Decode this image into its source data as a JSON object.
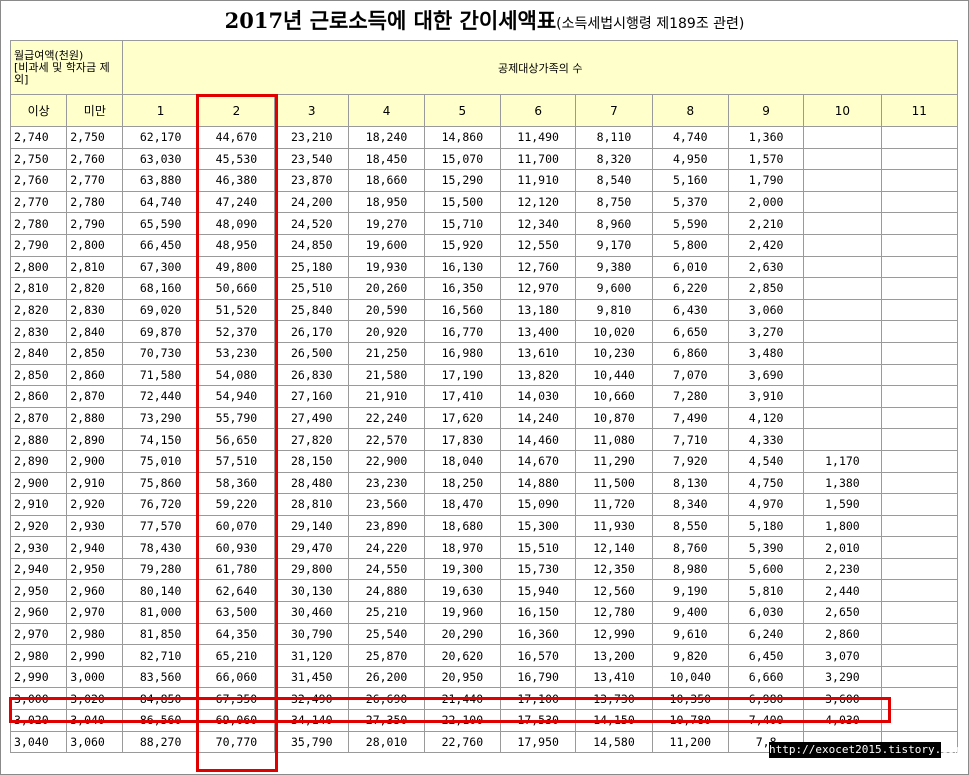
{
  "title": {
    "main": "2017년 근로소득에 대한 간이세액표",
    "sub": "(소득세법시행령 제189조 관련)"
  },
  "header": {
    "income": "월급여액(천원)\n[비과세 및 학자금 제외]",
    "family": "공제대상가족의 수",
    "cols": [
      "이상",
      "미만",
      "1",
      "2",
      "3",
      "4",
      "5",
      "6",
      "7",
      "8",
      "9",
      "10",
      "11"
    ]
  },
  "rows": [
    [
      "2,740",
      "2,750",
      "62,170",
      "44,670",
      "23,210",
      "18,240",
      "14,860",
      "11,490",
      "8,110",
      "4,740",
      "1,360",
      "",
      ""
    ],
    [
      "2,750",
      "2,760",
      "63,030",
      "45,530",
      "23,540",
      "18,450",
      "15,070",
      "11,700",
      "8,320",
      "4,950",
      "1,570",
      "",
      ""
    ],
    [
      "2,760",
      "2,770",
      "63,880",
      "46,380",
      "23,870",
      "18,660",
      "15,290",
      "11,910",
      "8,540",
      "5,160",
      "1,790",
      "",
      ""
    ],
    [
      "2,770",
      "2,780",
      "64,740",
      "47,240",
      "24,200",
      "18,950",
      "15,500",
      "12,120",
      "8,750",
      "5,370",
      "2,000",
      "",
      ""
    ],
    [
      "2,780",
      "2,790",
      "65,590",
      "48,090",
      "24,520",
      "19,270",
      "15,710",
      "12,340",
      "8,960",
      "5,590",
      "2,210",
      "",
      ""
    ],
    [
      "2,790",
      "2,800",
      "66,450",
      "48,950",
      "24,850",
      "19,600",
      "15,920",
      "12,550",
      "9,170",
      "5,800",
      "2,420",
      "",
      ""
    ],
    [
      "2,800",
      "2,810",
      "67,300",
      "49,800",
      "25,180",
      "19,930",
      "16,130",
      "12,760",
      "9,380",
      "6,010",
      "2,630",
      "",
      ""
    ],
    [
      "2,810",
      "2,820",
      "68,160",
      "50,660",
      "25,510",
      "20,260",
      "16,350",
      "12,970",
      "9,600",
      "6,220",
      "2,850",
      "",
      ""
    ],
    [
      "2,820",
      "2,830",
      "69,020",
      "51,520",
      "25,840",
      "20,590",
      "16,560",
      "13,180",
      "9,810",
      "6,430",
      "3,060",
      "",
      ""
    ],
    [
      "2,830",
      "2,840",
      "69,870",
      "52,370",
      "26,170",
      "20,920",
      "16,770",
      "13,400",
      "10,020",
      "6,650",
      "3,270",
      "",
      ""
    ],
    [
      "2,840",
      "2,850",
      "70,730",
      "53,230",
      "26,500",
      "21,250",
      "16,980",
      "13,610",
      "10,230",
      "6,860",
      "3,480",
      "",
      ""
    ],
    [
      "2,850",
      "2,860",
      "71,580",
      "54,080",
      "26,830",
      "21,580",
      "17,190",
      "13,820",
      "10,440",
      "7,070",
      "3,690",
      "",
      ""
    ],
    [
      "2,860",
      "2,870",
      "72,440",
      "54,940",
      "27,160",
      "21,910",
      "17,410",
      "14,030",
      "10,660",
      "7,280",
      "3,910",
      "",
      ""
    ],
    [
      "2,870",
      "2,880",
      "73,290",
      "55,790",
      "27,490",
      "22,240",
      "17,620",
      "14,240",
      "10,870",
      "7,490",
      "4,120",
      "",
      ""
    ],
    [
      "2,880",
      "2,890",
      "74,150",
      "56,650",
      "27,820",
      "22,570",
      "17,830",
      "14,460",
      "11,080",
      "7,710",
      "4,330",
      "",
      ""
    ],
    [
      "2,890",
      "2,900",
      "75,010",
      "57,510",
      "28,150",
      "22,900",
      "18,040",
      "14,670",
      "11,290",
      "7,920",
      "4,540",
      "1,170",
      ""
    ],
    [
      "2,900",
      "2,910",
      "75,860",
      "58,360",
      "28,480",
      "23,230",
      "18,250",
      "14,880",
      "11,500",
      "8,130",
      "4,750",
      "1,380",
      ""
    ],
    [
      "2,910",
      "2,920",
      "76,720",
      "59,220",
      "28,810",
      "23,560",
      "18,470",
      "15,090",
      "11,720",
      "8,340",
      "4,970",
      "1,590",
      ""
    ],
    [
      "2,920",
      "2,930",
      "77,570",
      "60,070",
      "29,140",
      "23,890",
      "18,680",
      "15,300",
      "11,930",
      "8,550",
      "5,180",
      "1,800",
      ""
    ],
    [
      "2,930",
      "2,940",
      "78,430",
      "60,930",
      "29,470",
      "24,220",
      "18,970",
      "15,510",
      "12,140",
      "8,760",
      "5,390",
      "2,010",
      ""
    ],
    [
      "2,940",
      "2,950",
      "79,280",
      "61,780",
      "29,800",
      "24,550",
      "19,300",
      "15,730",
      "12,350",
      "8,980",
      "5,600",
      "2,230",
      ""
    ],
    [
      "2,950",
      "2,960",
      "80,140",
      "62,640",
      "30,130",
      "24,880",
      "19,630",
      "15,940",
      "12,560",
      "9,190",
      "5,810",
      "2,440",
      ""
    ],
    [
      "2,960",
      "2,970",
      "81,000",
      "63,500",
      "30,460",
      "25,210",
      "19,960",
      "16,150",
      "12,780",
      "9,400",
      "6,030",
      "2,650",
      ""
    ],
    [
      "2,970",
      "2,980",
      "81,850",
      "64,350",
      "30,790",
      "25,540",
      "20,290",
      "16,360",
      "12,990",
      "9,610",
      "6,240",
      "2,860",
      ""
    ],
    [
      "2,980",
      "2,990",
      "82,710",
      "65,210",
      "31,120",
      "25,870",
      "20,620",
      "16,570",
      "13,200",
      "9,820",
      "6,450",
      "3,070",
      ""
    ],
    [
      "2,990",
      "3,000",
      "83,560",
      "66,060",
      "31,450",
      "26,200",
      "20,950",
      "16,790",
      "13,410",
      "10,040",
      "6,660",
      "3,290",
      ""
    ],
    [
      "3,000",
      "3,020",
      "84,850",
      "67,350",
      "32,490",
      "26,690",
      "21,440",
      "17,100",
      "13,730",
      "10,350",
      "6,980",
      "3,600",
      ""
    ],
    [
      "3,020",
      "3,040",
      "86,560",
      "69,060",
      "34,140",
      "27,350",
      "22,100",
      "17,530",
      "14,150",
      "10,780",
      "7,400",
      "4,030",
      ""
    ],
    [
      "3,040",
      "3,060",
      "88,270",
      "70,770",
      "35,790",
      "28,010",
      "22,760",
      "17,950",
      "14,580",
      "11,200",
      "7,8",
      "",
      ""
    ]
  ],
  "watermark": "http://exocet2015.tistory.com",
  "colors": {
    "header_bg": "#ffffcc",
    "highlight": "#e00000",
    "grid": "#9a9a9a"
  }
}
